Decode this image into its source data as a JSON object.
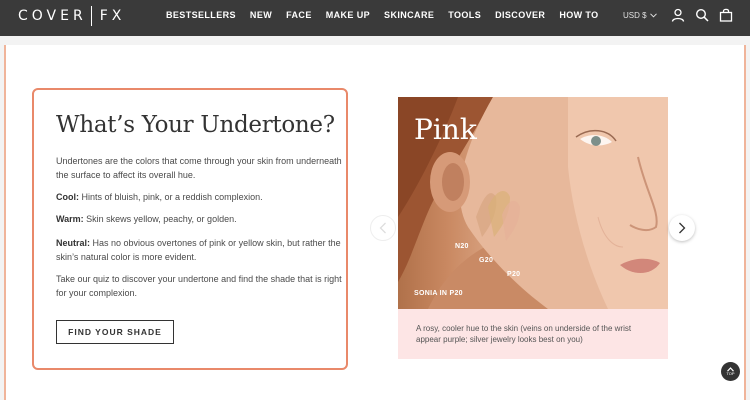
{
  "brand": {
    "word1": "COVER",
    "word2": "FX"
  },
  "nav": {
    "items": [
      {
        "label": "BESTSELLERS"
      },
      {
        "label": "NEW"
      },
      {
        "label": "FACE"
      },
      {
        "label": "MAKE UP"
      },
      {
        "label": "SKINCARE"
      },
      {
        "label": "TOOLS"
      },
      {
        "label": "DISCOVER"
      },
      {
        "label": "HOW TO"
      }
    ],
    "currency": "USD $",
    "icons": [
      "account-icon",
      "search-icon",
      "bag-icon"
    ]
  },
  "undertone": {
    "title": "What’s Your Undertone?",
    "intro": "Undertones are the colors that come through your skin from underneath the surface to affect its overall hue.",
    "cool_label": "Cool:",
    "cool_text": " Hints of bluish, pink, or a reddish complexion.",
    "warm_label": "Warm:",
    "warm_text": " Skin skews yellow, peachy, or golden.",
    "neutral_label": "Neutral:",
    "neutral_text": " Has no obvious overtones of pink or yellow skin, but rather the skin’s natural color is more evident.",
    "quiz_text": "Take our quiz to discover your undertone and find the shade that is right for your complexion.",
    "button_label": "FIND YOUR SHADE"
  },
  "slide": {
    "title": "Pink",
    "swatches": [
      "N20",
      "G20",
      "P20"
    ],
    "model_label": "SONIA IN P20",
    "caption": "A rosy, cooler hue to the skin (veins on underside of the wrist appear purple; silver jewelry looks best on you)"
  },
  "colors": {
    "header_bg": "#3a3a3a",
    "card_border": "#e9896a",
    "caption_bg": "#fde5e5"
  },
  "back_to_top": "TOP"
}
